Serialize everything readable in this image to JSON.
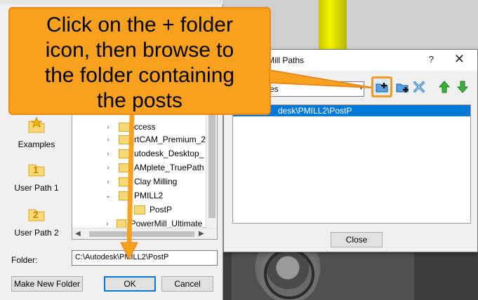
{
  "callout": {
    "line1": "Click on the + folder",
    "line2": "icon, then browse to",
    "line3": "the folder containing",
    "line4": "the posts"
  },
  "mill_paths_dialog": {
    "title": "Mill Paths",
    "help": "?",
    "close_glyph": "✕",
    "combo_value": "es",
    "list_items": [
      "desk\\PMILL2\\PostP"
    ],
    "close_button": "Close"
  },
  "browse_dialog": {
    "shortcuts": [
      "Examples",
      "User Path 1",
      "User Path 2"
    ],
    "tree": [
      {
        "label": "ccess",
        "chevron": "›"
      },
      {
        "label": "rtCAM_Premium_2",
        "chevron": "›"
      },
      {
        "label": "utodesk_Desktop_",
        "chevron": "›"
      },
      {
        "label": "AMplete_TruePath",
        "chevron": "›"
      },
      {
        "label": "Clay Milling",
        "chevron": "›"
      },
      {
        "label": "PMILL2",
        "chevron": "⌄"
      },
      {
        "label": "PostP",
        "chevron": ""
      },
      {
        "label": "PowerMill_Ultimate_",
        "chevron": "›"
      }
    ],
    "folder_label": "Folder:",
    "folder_value": "C:\\Autodesk\\PMILL2\\PostP",
    "buttons": {
      "new_folder": "Make New Folder",
      "ok": "OK",
      "cancel": "Cancel"
    }
  },
  "colors": {
    "callout": "#f7a11e",
    "selection": "#0078d7"
  }
}
